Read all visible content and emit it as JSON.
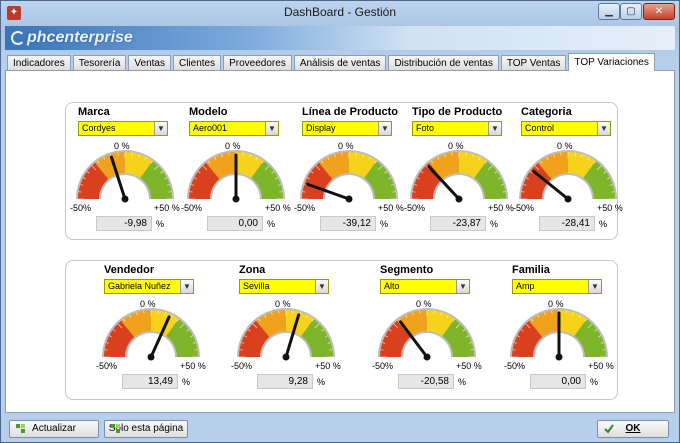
{
  "window": {
    "title": "DashBoard - Gestión"
  },
  "brand": {
    "text": "phcenterprise"
  },
  "tabs": [
    {
      "label": "Indicadores"
    },
    {
      "label": "Tesorería"
    },
    {
      "label": "Ventas"
    },
    {
      "label": "Clientes"
    },
    {
      "label": "Proveedores"
    },
    {
      "label": "Análisis de ventas"
    },
    {
      "label": "Distribución de ventas"
    },
    {
      "label": "TOP Ventas"
    },
    {
      "label": "TOP Variaciones",
      "active": true
    }
  ],
  "scale": {
    "zero": "0 %",
    "neg": "-50%",
    "pos": "+50 %",
    "pct": "%"
  },
  "gauges_top": [
    {
      "label": "Marca",
      "combo": "Cordyes",
      "value_text": "-9,98",
      "value": -9.98
    },
    {
      "label": "Modelo",
      "combo": "Aero001",
      "value_text": "0,00",
      "value": 0.0
    },
    {
      "label": "Línea de Producto",
      "combo": "Display",
      "value_text": "-39,12",
      "value": -39.12
    },
    {
      "label": "Tipo de Producto",
      "combo": "Foto",
      "value_text": "-23,87",
      "value": -23.87
    },
    {
      "label": "Categoria",
      "combo": "Control",
      "value_text": "-28,41",
      "value": -28.41
    }
  ],
  "gauges_bottom": [
    {
      "label": "Vendedor",
      "combo": "Gabriela Nuñez",
      "value_text": "13,49",
      "value": 13.49
    },
    {
      "label": "Zona",
      "combo": "Sevilla",
      "value_text": "9,28",
      "value": 9.28
    },
    {
      "label": "Segmento",
      "combo": "Alto",
      "value_text": "-20,58",
      "value": -20.58
    },
    {
      "label": "Familia",
      "combo": "Amp",
      "value_text": "0,00",
      "value": 0.0
    }
  ],
  "buttons": {
    "actualizar": "Actualizar",
    "solo": "Solo esta página",
    "ok": "OK"
  },
  "colors": {
    "red": "#d9411e",
    "orange": "#f0a21c",
    "yellow": "#f7d21a",
    "green": "#7fb52a"
  }
}
